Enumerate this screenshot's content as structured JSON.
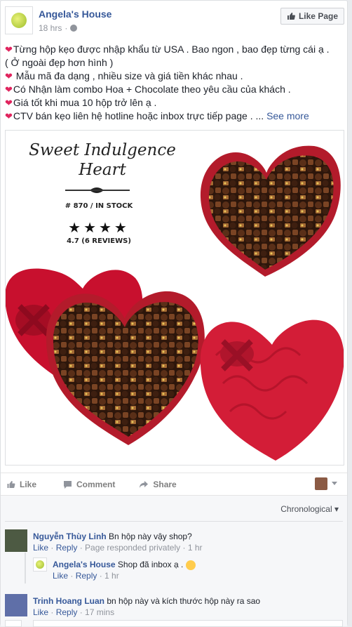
{
  "post": {
    "page_name": "Angela's House",
    "time": "18 hrs",
    "like_page_label": "Like Page",
    "text_lines": [
      "Từng hộp kẹo được nhập khẩu từ USA . Bao ngon , bao đẹp từng cái ạ .",
      "( Ở ngoài đẹp hơn hình )",
      " Mẫu mã đa dạng , nhiều size và giá tiền khác nhau .",
      "Có Nhận làm combo Hoa + Chocolate theo yêu cầu của khách .",
      "Giá tốt khi mua 10 hộp trở lên ạ .",
      "CTV bán kẹo liên hệ hotline hoặc inbox trực tiếp page . ..."
    ],
    "see_more": "See more"
  },
  "media": {
    "title_line1": "Sweet Indulgence",
    "title_line2": "Heart",
    "stock": "# 870 / IN STOCK",
    "stars": "★★★★",
    "reviews": "4.7 (6 REVIEWS)"
  },
  "actions": {
    "like": "Like",
    "comment": "Comment",
    "share": "Share"
  },
  "comments": {
    "sort_label": "Chronological",
    "items": [
      {
        "author": "Nguyễn Thùy Linh",
        "text": "Bn hộp này vậy shop?",
        "like": "Like",
        "reply": "Reply",
        "meta": "Page responded privately",
        "time": "1 hr"
      },
      {
        "author": "Angela's House",
        "text": "Shop đã inbox ạ .",
        "like": "Like",
        "reply": "Reply",
        "time": "1 hr"
      },
      {
        "author": "Trinh Hoang Luan",
        "text": "bn hộp này và kích thước hộp này ra sao",
        "like": "Like",
        "reply": "Reply",
        "time": "17 mins"
      }
    ]
  },
  "colors": {
    "link_blue": "#365899",
    "heart_red": "#e0245e",
    "box_red": "#c8102e"
  }
}
